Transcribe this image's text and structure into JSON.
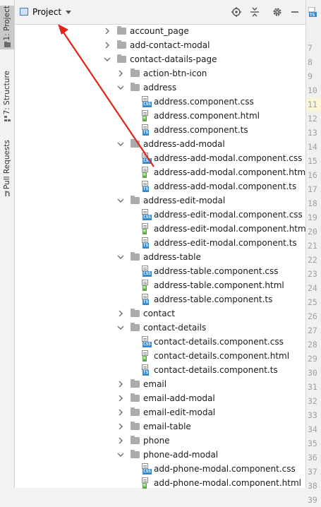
{
  "sidebar": {
    "tabs": [
      {
        "label": "1: Project",
        "active": true,
        "icon": "folder-icon"
      },
      {
        "label": "7: Structure",
        "active": false,
        "icon": "structure-icon"
      },
      {
        "label": "Pull Requests",
        "active": false,
        "icon": "pull-request-icon"
      }
    ]
  },
  "header": {
    "title": "Project",
    "icons": [
      "locate-icon",
      "collapse-all-icon",
      "gear-icon",
      "hide-icon"
    ]
  },
  "tree": [
    {
      "label": "account_page",
      "kind": "folder",
      "depth": 0,
      "expanded": false
    },
    {
      "label": "add-contact-modal",
      "kind": "folder",
      "depth": 0,
      "expanded": false
    },
    {
      "label": "contact-datails-page",
      "kind": "folder",
      "depth": 0,
      "expanded": true
    },
    {
      "label": "action-btn-icon",
      "kind": "folder",
      "depth": 1,
      "expanded": false
    },
    {
      "label": "address",
      "kind": "folder",
      "depth": 1,
      "expanded": true
    },
    {
      "label": "address.component.css",
      "kind": "css",
      "depth": 2
    },
    {
      "label": "address.component.html",
      "kind": "html",
      "depth": 2
    },
    {
      "label": "address.component.ts",
      "kind": "ts",
      "depth": 2
    },
    {
      "label": "address-add-modal",
      "kind": "folder",
      "depth": 1,
      "expanded": true
    },
    {
      "label": "address-add-modal.component.css",
      "kind": "css",
      "depth": 2
    },
    {
      "label": "address-add-modal.component.html",
      "kind": "html",
      "depth": 2
    },
    {
      "label": "address-add-modal.component.ts",
      "kind": "ts",
      "depth": 2
    },
    {
      "label": "address-edit-modal",
      "kind": "folder",
      "depth": 1,
      "expanded": true
    },
    {
      "label": "address-edit-modal.component.css",
      "kind": "css",
      "depth": 2
    },
    {
      "label": "address-edit-modal.component.html",
      "kind": "html",
      "depth": 2
    },
    {
      "label": "address-edit-modal.component.ts",
      "kind": "ts",
      "depth": 2
    },
    {
      "label": "address-table",
      "kind": "folder",
      "depth": 1,
      "expanded": true
    },
    {
      "label": "address-table.component.css",
      "kind": "css",
      "depth": 2
    },
    {
      "label": "address-table.component.html",
      "kind": "html",
      "depth": 2
    },
    {
      "label": "address-table.component.ts",
      "kind": "ts",
      "depth": 2
    },
    {
      "label": "contact",
      "kind": "folder",
      "depth": 1,
      "expanded": false
    },
    {
      "label": "contact-details",
      "kind": "folder",
      "depth": 1,
      "expanded": true
    },
    {
      "label": "contact-details.component.css",
      "kind": "css",
      "depth": 2
    },
    {
      "label": "contact-details.component.html",
      "kind": "html",
      "depth": 2
    },
    {
      "label": "contact-details.component.ts",
      "kind": "ts",
      "depth": 2
    },
    {
      "label": "email",
      "kind": "folder",
      "depth": 1,
      "expanded": false
    },
    {
      "label": "email-add-modal",
      "kind": "folder",
      "depth": 1,
      "expanded": false
    },
    {
      "label": "email-edit-modal",
      "kind": "folder",
      "depth": 1,
      "expanded": false
    },
    {
      "label": "email-table",
      "kind": "folder",
      "depth": 1,
      "expanded": false
    },
    {
      "label": "phone",
      "kind": "folder",
      "depth": 1,
      "expanded": false
    },
    {
      "label": "phone-add-modal",
      "kind": "folder",
      "depth": 1,
      "expanded": true
    },
    {
      "label": "add-phone-modal.component.css",
      "kind": "css",
      "depth": 2
    },
    {
      "label": "add-phone-modal.component.html",
      "kind": "html",
      "depth": 2
    }
  ],
  "badges": {
    "css": "CSS",
    "html": "H",
    "ts": "TS"
  },
  "editor": {
    "tab_icon": "ts-file-icon",
    "line_numbers": [
      "7",
      "8",
      "9",
      "10",
      "11",
      "12",
      "13",
      "14",
      "15",
      "16",
      "17",
      "18",
      "19",
      "20",
      "21",
      "22",
      "23",
      "24",
      "25",
      "26",
      "27",
      "28",
      "29",
      "30",
      "31",
      "32",
      "33",
      "34",
      "35",
      "36",
      "37",
      "38",
      "39"
    ],
    "highlighted_line": "11"
  },
  "annotation": {
    "color": "#e0241b"
  }
}
